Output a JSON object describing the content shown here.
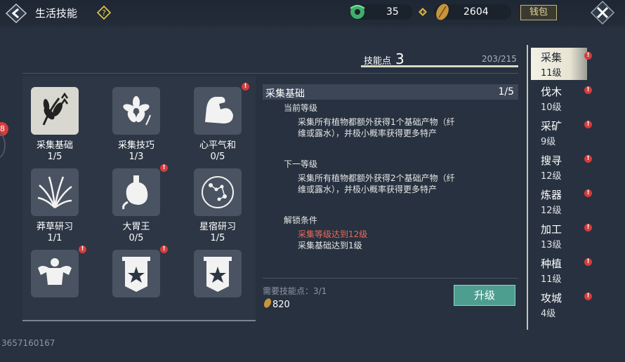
{
  "header": {
    "title": "生活技能",
    "help_icon": "question-diamond-icon",
    "jade_value": "35",
    "gold_value": "2604",
    "wallet_label": "钱包"
  },
  "points": {
    "label": "技能点",
    "value": "3",
    "progress_text": "203/215",
    "progress_fraction": 0.944
  },
  "skills": [
    {
      "name": "采集基础",
      "level": "1/5",
      "icon": "plant-leaves-icon",
      "alert": false
    },
    {
      "name": "采集技巧",
      "level": "1/3",
      "icon": "flower-icon",
      "alert": false
    },
    {
      "name": "心平气和",
      "level": "0/5",
      "icon": "muscle-arm-icon",
      "alert": true
    },
    {
      "name": "莽草研习",
      "level": "1/1",
      "icon": "grass-bundle-icon",
      "alert": false
    },
    {
      "name": "大胃王",
      "level": "0/5",
      "icon": "stomach-icon",
      "alert": true
    },
    {
      "name": "星宿研习",
      "level": "1/5",
      "icon": "constellation-icon",
      "alert": false
    },
    {
      "name": "",
      "level": "",
      "icon": "strongman-icon",
      "alert": true
    },
    {
      "name": "",
      "level": "",
      "icon": "banner-star-icon",
      "alert": true
    },
    {
      "name": "",
      "level": "",
      "icon": "banner-star-icon",
      "alert": false
    }
  ],
  "detail": {
    "name": "采集基础",
    "level": "1/5",
    "current_title": "当前等级",
    "current_desc_1": "采集所有植物都额外获得1个基础产物（纤",
    "current_desc_2": "维或露水），并极小概率获得更多特产",
    "next_title": "下一等级",
    "next_desc_1": "采集所有植物都额外获得2个基础产物（纤",
    "next_desc_2": "维或露水），并极小概率获得更多特产",
    "unlock_title": "解锁条件",
    "unlock_cond_1": "采集等级达到12级",
    "unlock_cond_2": "采集基础达到1级",
    "need_points": "需要技能点：3/1",
    "cost": "820",
    "upgrade_label": "升级"
  },
  "categories": [
    {
      "name": "采集",
      "level": "11级",
      "active": true
    },
    {
      "name": "伐木",
      "level": "10级"
    },
    {
      "name": "采矿",
      "level": "9级"
    },
    {
      "name": "搜寻",
      "level": "12级"
    },
    {
      "name": "炼器",
      "level": "12级"
    },
    {
      "name": "加工",
      "level": "13级"
    },
    {
      "name": "种植",
      "level": "11级"
    },
    {
      "name": "攻城",
      "level": "4级"
    }
  ],
  "side_badge": "8",
  "uid": "3657160167",
  "colors": {
    "background": "#27313f",
    "upgrade_button": "#4e9e90",
    "alert": "#d63c3c",
    "warn_text": "#e86a5a"
  }
}
